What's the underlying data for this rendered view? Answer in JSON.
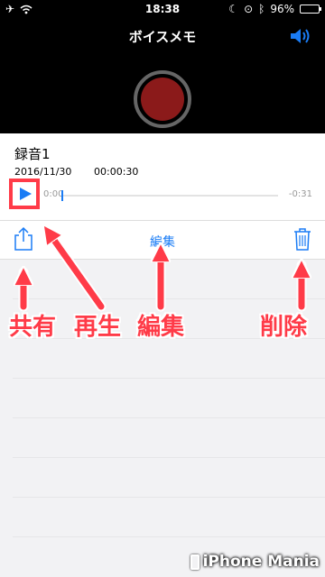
{
  "status_bar": {
    "time": "18:38",
    "battery": "96%",
    "icons": [
      "airplane-icon",
      "wifi-icon",
      "moon-icon",
      "rotation-lock-icon",
      "bluetooth-icon",
      "battery-icon"
    ]
  },
  "header": {
    "title": "ボイスメモ",
    "speaker_icon": "speaker-icon",
    "record_icon": "record-icon"
  },
  "recording": {
    "name": "録音1",
    "date": "2016/11/30",
    "duration": "00:00:30",
    "elapsed": "0:00",
    "remaining": "-0:31",
    "progress": 0.0
  },
  "toolbar": {
    "share_icon": "share-icon",
    "edit_label": "編集",
    "trash_icon": "trash-icon"
  },
  "annotations": {
    "share": "共有",
    "play": "再生",
    "edit": "編集",
    "delete": "削除"
  },
  "watermark": {
    "text": "iPhone Mania"
  },
  "colors": {
    "accent": "#1a7cf5",
    "annotation": "#ff3b48",
    "record": "#8b1a1a"
  }
}
